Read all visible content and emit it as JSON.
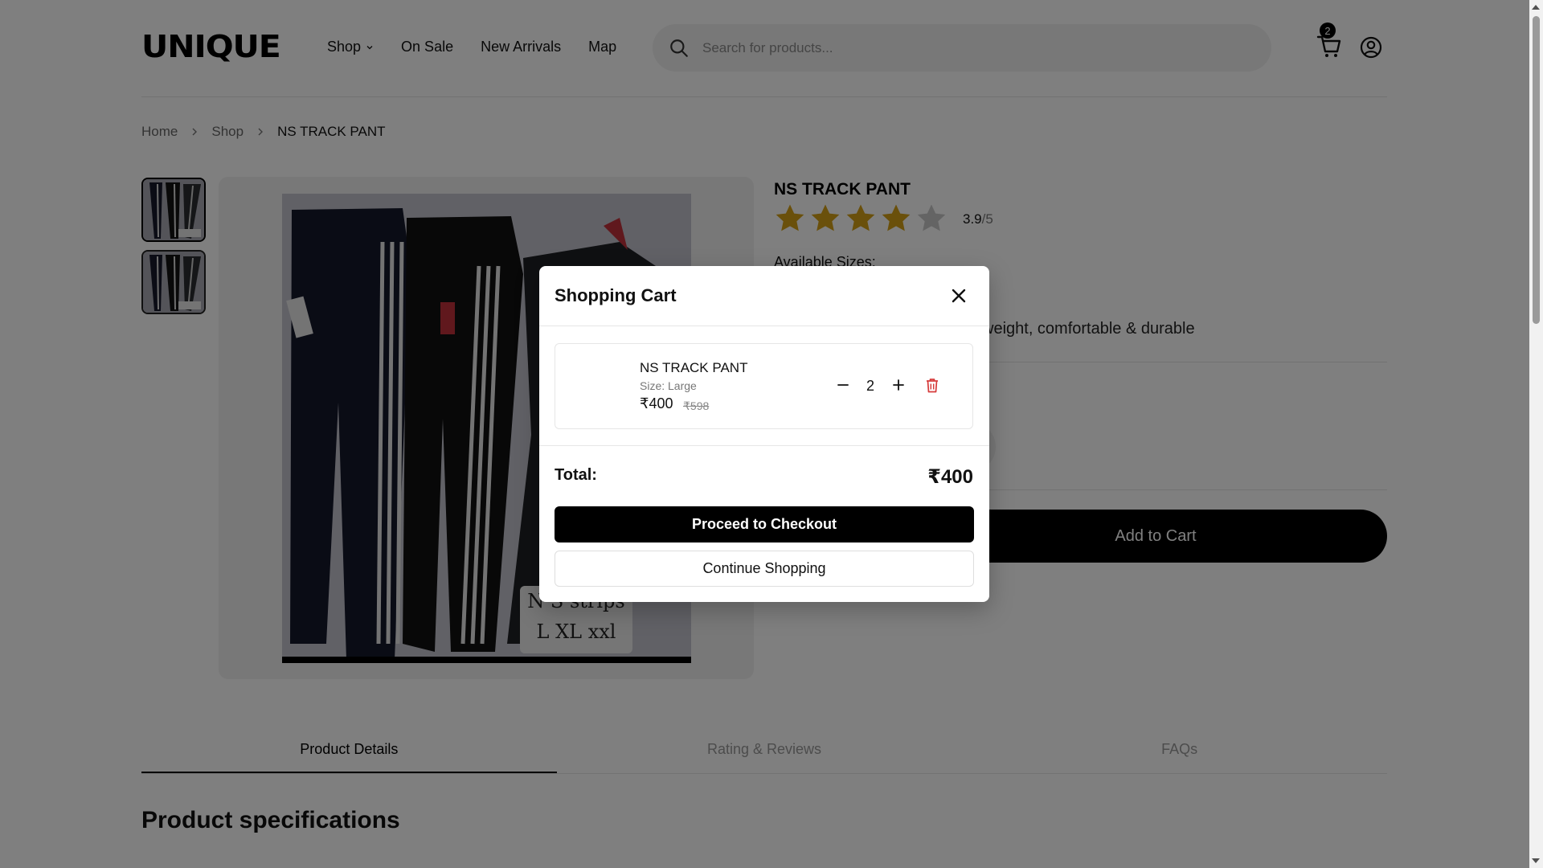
{
  "header": {
    "logo": "UNIQUE",
    "nav": [
      "Shop",
      "On Sale",
      "New Arrivals",
      "Map"
    ],
    "search_placeholder": "Search for products...",
    "cart_count": "2"
  },
  "breadcrumb": [
    "Home",
    "Shop",
    "NS TRACK PANT"
  ],
  "product": {
    "title": "NS TRACK PANT",
    "rating": "3.9",
    "rating_max": "/5",
    "sizes_label": "Available Sizes:",
    "description_fragment": "weight, comfortable & durable",
    "add_to_cart": "Add to Cart",
    "image_caption_1": "N S strips",
    "image_caption_2": "L XL xxl"
  },
  "tabs": [
    "Product Details",
    "Rating & Reviews",
    "FAQs"
  ],
  "section_title": "Product specifications",
  "cart_modal": {
    "title": "Shopping Cart",
    "item": {
      "name": "NS TRACK PANT",
      "size": "Size: Large",
      "price": "₹400",
      "old_price": "₹598",
      "quantity": "2"
    },
    "total_label": "Total:",
    "total_value": "₹400",
    "checkout_label": "Proceed to Checkout",
    "continue_label": "Continue Shopping"
  },
  "colors": {
    "accent": "#000000",
    "star": "#d4a017",
    "star_empty": "#c8c8c8",
    "delete": "#d63b3b"
  }
}
